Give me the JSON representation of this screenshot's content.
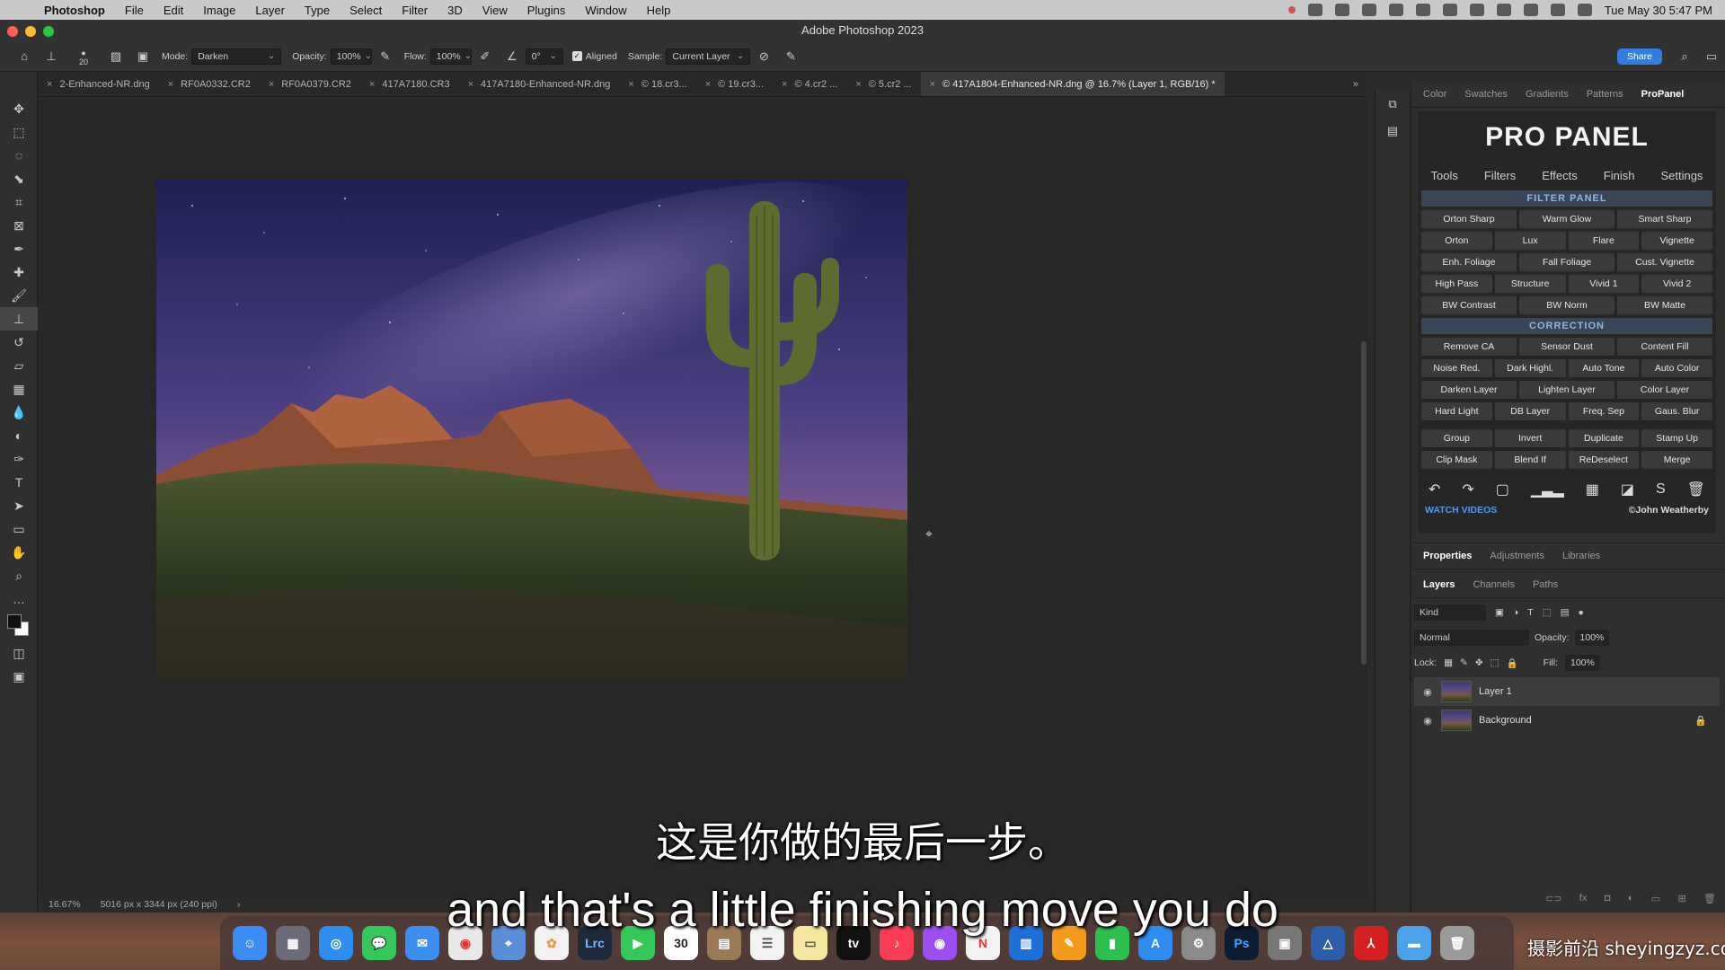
{
  "menubar": {
    "app": "Photoshop",
    "items": [
      "File",
      "Edit",
      "Image",
      "Layer",
      "Type",
      "Select",
      "Filter",
      "3D",
      "View",
      "Plugins",
      "Window",
      "Help"
    ],
    "clock": "Tue May 30  5:47 PM"
  },
  "window": {
    "title": "Adobe Photoshop 2023"
  },
  "options": {
    "brush_size": "20",
    "mode_label": "Mode:",
    "mode_value": "Darken",
    "opacity_label": "Opacity:",
    "opacity_value": "100%",
    "flow_label": "Flow:",
    "flow_value": "100%",
    "angle_value": "0°",
    "aligned_label": "Aligned",
    "sample_label": "Sample:",
    "sample_value": "Current Layer",
    "share_label": "Share"
  },
  "tabs": [
    {
      "label": "2-Enhanced-NR.dng"
    },
    {
      "label": "RF0A0332.CR2"
    },
    {
      "label": "RF0A0379.CR2"
    },
    {
      "label": "417A7180.CR3"
    },
    {
      "label": "417A7180-Enhanced-NR.dng"
    },
    {
      "label": "© 18.cr3..."
    },
    {
      "label": "© 19.cr3..."
    },
    {
      "label": "© 4.cr2 ..."
    },
    {
      "label": "© 5.cr2 ..."
    },
    {
      "label": "© 417A1804-Enhanced-NR.dng @ 16.7% (Layer 1, RGB/16) *"
    }
  ],
  "status": {
    "zoom": "16.67%",
    "doc_size": "5016 px x 3344 px (240 ppi)"
  },
  "panel_tabs": [
    "Color",
    "Swatches",
    "Gradients",
    "Patterns",
    "ProPanel"
  ],
  "propanel": {
    "logo": "PRO PANEL",
    "nav": [
      "Tools",
      "Filters",
      "Effects",
      "Finish",
      "Settings"
    ],
    "filter_header": "FILTER PANEL",
    "filter_rows": [
      [
        "Orton Sharp",
        "Warm Glow",
        "Smart Sharp"
      ],
      [
        "Orton",
        "Lux",
        "Flare",
        "Vignette"
      ],
      [
        "Enh. Foliage",
        "Fall Foliage",
        "Cust. Vignette"
      ],
      [
        "High Pass",
        "Structure",
        "Vivid 1",
        "Vivid 2"
      ],
      [
        "BW Contrast",
        "BW Norm",
        "BW Matte"
      ]
    ],
    "correction_header": "CORRECTION",
    "correction_rows": [
      [
        "Remove CA",
        "Sensor Dust",
        "Content Fill"
      ],
      [
        "Noise Red.",
        "Dark Highl.",
        "Auto Tone",
        "Auto Color"
      ],
      [
        "Darken Layer",
        "Lighten Layer",
        "Color Layer"
      ],
      [
        "Hard Light",
        "DB Layer",
        "Freq. Sep",
        "Gaus. Blur"
      ]
    ],
    "layer_rows": [
      [
        "Group",
        "Invert",
        "Duplicate",
        "Stamp Up"
      ],
      [
        "Clip Mask",
        "Blend If",
        "ReDeselect",
        "Merge"
      ]
    ],
    "watch": "WATCH VIDEOS",
    "credit": "©John Weatherby"
  },
  "props_tabs": [
    "Properties",
    "Adjustments",
    "Libraries"
  ],
  "layers_tabs": [
    "Layers",
    "Channels",
    "Paths"
  ],
  "layers": {
    "kind": "Kind",
    "blend": "Normal",
    "opacity_label": "Opacity:",
    "opacity": "100%",
    "lock_label": "Lock:",
    "fill_label": "Fill:",
    "fill": "100%",
    "items": [
      {
        "name": "Layer 1"
      },
      {
        "name": "Background"
      }
    ]
  },
  "subtitles": {
    "zh": "这是你做的最后一步。",
    "en": "and that's a little finishing move you do"
  },
  "dock": {
    "lrc": "Lrc",
    "cal": "30",
    "tv": "tv",
    "ps": "Ps"
  },
  "watermark": "摄影前沿 sheyingzyz.com"
}
